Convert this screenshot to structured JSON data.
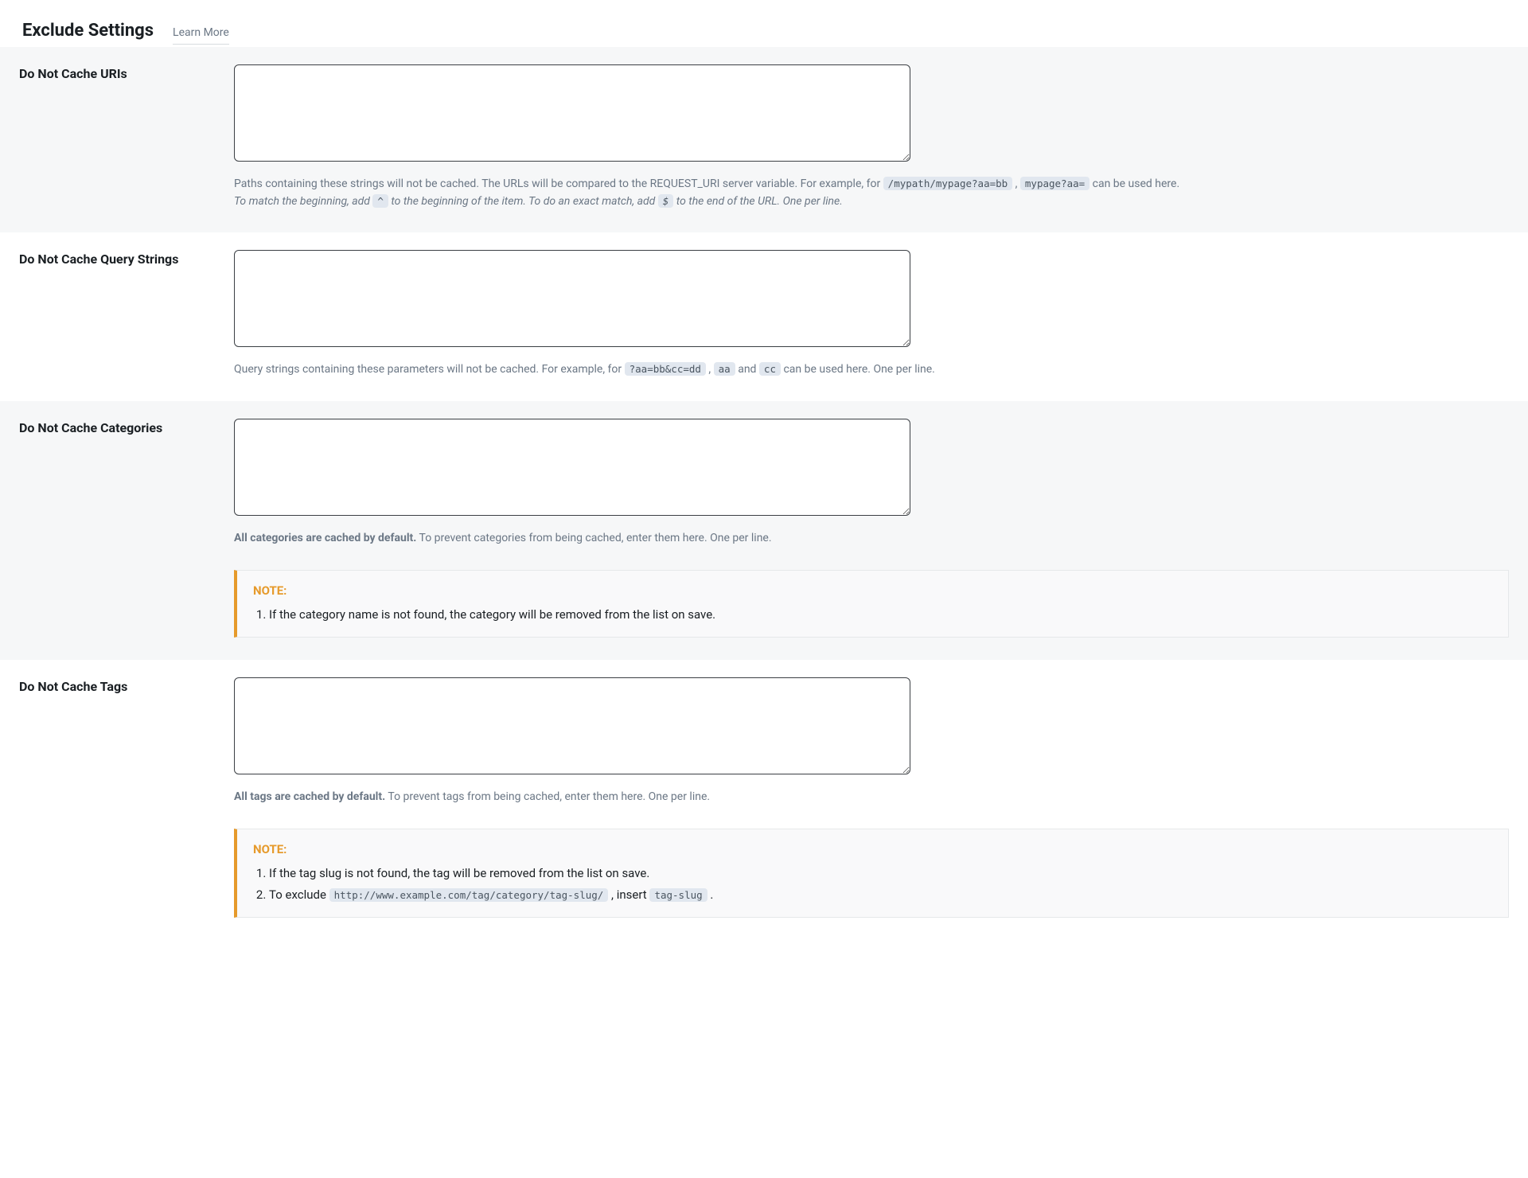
{
  "header": {
    "title": "Exclude Settings",
    "learn_more": "Learn More"
  },
  "uris": {
    "label": "Do Not Cache URIs",
    "value": "",
    "help_pre": "Paths containing these strings will not be cached. The URLs will be compared to the REQUEST_URI server variable. For example, for ",
    "code1": "/mypath/mypage?aa=bb",
    "sep1": " , ",
    "code2": "mypage?aa=",
    "help_post": " can be used here.",
    "italic_pre": "To match the beginning, add ",
    "caret": "^",
    "italic_mid": " to the beginning of the item. To do an exact match, add ",
    "dollar": "$",
    "italic_post": " to the end of the URL. One per line."
  },
  "qs": {
    "label": "Do Not Cache Query Strings",
    "value": "",
    "help_pre": "Query strings containing these parameters will not be cached. For example, for ",
    "code1": "?aa=bb&cc=dd",
    "sep1": " , ",
    "code2": "aa",
    "mid": " and ",
    "code3": "cc",
    "help_post": " can be used here. One per line."
  },
  "cats": {
    "label": "Do Not Cache Categories",
    "value": "",
    "help_bold": "All categories are cached by default.",
    "help_rest": " To prevent categories from being cached, enter them here. One per line.",
    "note_title": "NOTE:",
    "note1": "If the category name is not found, the category will be removed from the list on save."
  },
  "tags": {
    "label": "Do Not Cache Tags",
    "value": "",
    "help_bold": "All tags are cached by default.",
    "help_rest": " To prevent tags from being cached, enter them here. One per line.",
    "note_title": "NOTE:",
    "note1": "If the tag slug is not found, the tag will be removed from the list on save.",
    "note2_pre": "To exclude ",
    "note2_code1": "http://www.example.com/tag/category/tag-slug/",
    "note2_mid": " , insert ",
    "note2_code2": "tag-slug",
    "note2_post": " ."
  }
}
